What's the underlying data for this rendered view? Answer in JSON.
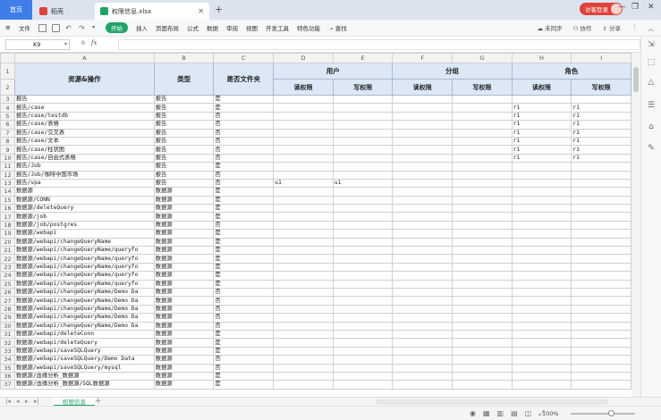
{
  "titlebar": {
    "home_tab": "首页",
    "doc_tab": "稻壳",
    "file_tab": "权限信息.xlsx",
    "login": "访客登录",
    "add_tab": "+"
  },
  "menu": {
    "file": "文件",
    "start": "开始",
    "items": [
      "插入",
      "页面布局",
      "公式",
      "数据",
      "审阅",
      "视图",
      "开发工具",
      "特色功能"
    ],
    "search": "查找",
    "unsynced": "未同步",
    "collab": "协作",
    "share": "分享"
  },
  "formula": {
    "cell_ref": "K9",
    "fx": "fx",
    "value": ""
  },
  "columns": [
    "A",
    "B",
    "C",
    "D",
    "E",
    "F",
    "G",
    "H",
    "I"
  ],
  "header": {
    "resource": "资源&操作",
    "type": "类型",
    "is_folder": "是否文件夹",
    "user": "用户",
    "group": "分组",
    "role": "角色",
    "read": "读权限",
    "write": "写权限"
  },
  "rows": [
    {
      "n": "3",
      "a": "报告",
      "b": "报告",
      "c": "是",
      "d": "",
      "e": "",
      "f": "",
      "g": "",
      "h": "",
      "i": ""
    },
    {
      "n": "4",
      "a": "报告/case",
      "b": "报告",
      "c": "是",
      "d": "",
      "e": "",
      "f": "",
      "g": "",
      "h": "r1",
      "i": "r1"
    },
    {
      "n": "5",
      "a": "报告/case/testdb",
      "b": "报告",
      "c": "否",
      "d": "",
      "e": "",
      "f": "",
      "g": "",
      "h": "r1",
      "i": "r1"
    },
    {
      "n": "6",
      "a": "报告/case/表格",
      "b": "报告",
      "c": "否",
      "d": "",
      "e": "",
      "f": "",
      "g": "",
      "h": "r1",
      "i": "r1"
    },
    {
      "n": "7",
      "a": "报告/case/交叉表",
      "b": "报告",
      "c": "否",
      "d": "",
      "e": "",
      "f": "",
      "g": "",
      "h": "r1",
      "i": "r1"
    },
    {
      "n": "8",
      "a": "报告/case/文本",
      "b": "报告",
      "c": "否",
      "d": "",
      "e": "",
      "f": "",
      "g": "",
      "h": "r1",
      "i": "r1"
    },
    {
      "n": "9",
      "a": "报告/case/柱状图",
      "b": "报告",
      "c": "否",
      "d": "",
      "e": "",
      "f": "",
      "g": "",
      "h": "r1",
      "i": "r1"
    },
    {
      "n": "10",
      "a": "报告/case/自由式表格",
      "b": "报告",
      "c": "否",
      "d": "",
      "e": "",
      "f": "",
      "g": "",
      "h": "r1",
      "i": "r1"
    },
    {
      "n": "11",
      "a": "报告/Job",
      "b": "报告",
      "c": "是",
      "d": "",
      "e": "",
      "f": "",
      "g": "",
      "h": "",
      "i": ""
    },
    {
      "n": "12",
      "a": "报告/Job/咖啡中国市场",
      "b": "报告",
      "c": "否",
      "d": "",
      "e": "",
      "f": "",
      "g": "",
      "h": "",
      "i": ""
    },
    {
      "n": "13",
      "a": "报告/vpa",
      "b": "报告",
      "c": "否",
      "d": "u1",
      "e": "u1",
      "f": "",
      "g": "",
      "h": "",
      "i": ""
    },
    {
      "n": "14",
      "a": "数据源",
      "b": "数据源",
      "c": "是",
      "d": "",
      "e": "",
      "f": "",
      "g": "",
      "h": "",
      "i": ""
    },
    {
      "n": "15",
      "a": "数据源/CONN",
      "b": "数据源",
      "c": "是",
      "d": "",
      "e": "",
      "f": "",
      "g": "",
      "h": "",
      "i": ""
    },
    {
      "n": "16",
      "a": "数据源/deleteQuery",
      "b": "数据源",
      "c": "是",
      "d": "",
      "e": "",
      "f": "",
      "g": "",
      "h": "",
      "i": ""
    },
    {
      "n": "17",
      "a": "数据源/job",
      "b": "数据源",
      "c": "是",
      "d": "",
      "e": "",
      "f": "",
      "g": "",
      "h": "",
      "i": ""
    },
    {
      "n": "18",
      "a": "数据源/job/postgres",
      "b": "数据源",
      "c": "否",
      "d": "",
      "e": "",
      "f": "",
      "g": "",
      "h": "",
      "i": ""
    },
    {
      "n": "19",
      "a": "数据源/webapi",
      "b": "数据源",
      "c": "是",
      "d": "",
      "e": "",
      "f": "",
      "g": "",
      "h": "",
      "i": ""
    },
    {
      "n": "20",
      "a": "数据源/webapi/changeQueryName",
      "b": "数据源",
      "c": "是",
      "d": "",
      "e": "",
      "f": "",
      "g": "",
      "h": "",
      "i": ""
    },
    {
      "n": "21",
      "a": "数据源/webapi/changeQueryName/queryfo",
      "b": "数据源",
      "c": "是",
      "d": "",
      "e": "",
      "f": "",
      "g": "",
      "h": "",
      "i": ""
    },
    {
      "n": "22",
      "a": "数据源/webapi/changeQueryName/queryfo",
      "b": "数据源",
      "c": "是",
      "d": "",
      "e": "",
      "f": "",
      "g": "",
      "h": "",
      "i": ""
    },
    {
      "n": "23",
      "a": "数据源/webapi/changeQueryName/queryfo",
      "b": "数据源",
      "c": "是",
      "d": "",
      "e": "",
      "f": "",
      "g": "",
      "h": "",
      "i": ""
    },
    {
      "n": "24",
      "a": "数据源/webapi/changeQueryName/queryfo",
      "b": "数据源",
      "c": "是",
      "d": "",
      "e": "",
      "f": "",
      "g": "",
      "h": "",
      "i": ""
    },
    {
      "n": "25",
      "a": "数据源/webapi/changeQueryName/queryfo",
      "b": "数据源",
      "c": "是",
      "d": "",
      "e": "",
      "f": "",
      "g": "",
      "h": "",
      "i": ""
    },
    {
      "n": "26",
      "a": "数据源/webapi/changeQueryName/Demo Da",
      "b": "数据源",
      "c": "否",
      "d": "",
      "e": "",
      "f": "",
      "g": "",
      "h": "",
      "i": ""
    },
    {
      "n": "27",
      "a": "数据源/webapi/changeQueryName/Demo Da",
      "b": "数据源",
      "c": "否",
      "d": "",
      "e": "",
      "f": "",
      "g": "",
      "h": "",
      "i": ""
    },
    {
      "n": "28",
      "a": "数据源/webapi/changeQueryName/Demo Da",
      "b": "数据源",
      "c": "否",
      "d": "",
      "e": "",
      "f": "",
      "g": "",
      "h": "",
      "i": ""
    },
    {
      "n": "29",
      "a": "数据源/webapi/changeQueryName/Demo Da",
      "b": "数据源",
      "c": "否",
      "d": "",
      "e": "",
      "f": "",
      "g": "",
      "h": "",
      "i": ""
    },
    {
      "n": "30",
      "a": "数据源/webapi/changeQueryName/Demo Da",
      "b": "数据源",
      "c": "否",
      "d": "",
      "e": "",
      "f": "",
      "g": "",
      "h": "",
      "i": ""
    },
    {
      "n": "31",
      "a": "数据源/webapi/deleteConn",
      "b": "数据源",
      "c": "是",
      "d": "",
      "e": "",
      "f": "",
      "g": "",
      "h": "",
      "i": ""
    },
    {
      "n": "32",
      "a": "数据源/webapi/deleteQuery",
      "b": "数据源",
      "c": "是",
      "d": "",
      "e": "",
      "f": "",
      "g": "",
      "h": "",
      "i": ""
    },
    {
      "n": "33",
      "a": "数据源/webapi/saveSQLQuery",
      "b": "数据源",
      "c": "是",
      "d": "",
      "e": "",
      "f": "",
      "g": "",
      "h": "",
      "i": ""
    },
    {
      "n": "34",
      "a": "数据源/webapi/saveSQLQuery/Demo Data",
      "b": "数据源",
      "c": "否",
      "d": "",
      "e": "",
      "f": "",
      "g": "",
      "h": "",
      "i": ""
    },
    {
      "n": "35",
      "a": "数据源/webapi/saveSQLQuery/mysql",
      "b": "数据源",
      "c": "否",
      "d": "",
      "e": "",
      "f": "",
      "g": "",
      "h": "",
      "i": ""
    },
    {
      "n": "36",
      "a": "数据源/血缘分析_数据源",
      "b": "数据源",
      "c": "是",
      "d": "",
      "e": "",
      "f": "",
      "g": "",
      "h": "",
      "i": ""
    },
    {
      "n": "37",
      "a": "数据源/血缘分析_数据源/SQL数据源",
      "b": "数据源",
      "c": "是",
      "d": "",
      "e": "",
      "f": "",
      "g": "",
      "h": "",
      "i": ""
    }
  ],
  "sheet_tab": "权限信息",
  "status": {
    "zoom": "100%"
  },
  "colors": {
    "accent": "#21a366",
    "home_tab": "#3f7ee8",
    "login": "#e0413a",
    "header_fill": "#dde8f6"
  }
}
